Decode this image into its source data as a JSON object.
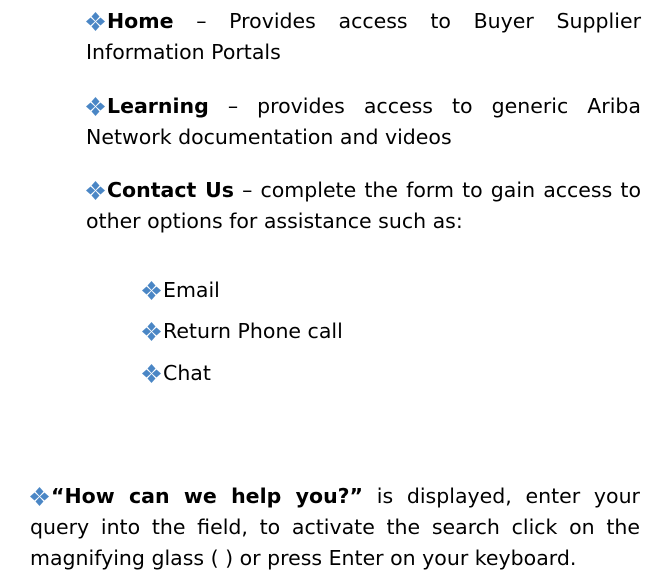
{
  "bullet_color": "#4a86c5",
  "bullet_icon": "diamond-cluster-icon",
  "items": {
    "home": {
      "label": "Home",
      "text": " – Provides access to Buyer Supplier Information Portals"
    },
    "learning": {
      "label": "Learning",
      "text": " – provides access to generic Ariba Network documentation and videos"
    },
    "contact": {
      "label": "Contact Us",
      "text": " – complete the form to gain access to other options for assistance such as:",
      "sub_items": [
        "Email",
        "Return Phone call",
        "Chat"
      ]
    },
    "help": {
      "label": "“How can we help you?”",
      "text": " is displayed, enter your query into the field, to activate the search click on the magnifying glass (    ) or press Enter on your keyboard."
    }
  }
}
